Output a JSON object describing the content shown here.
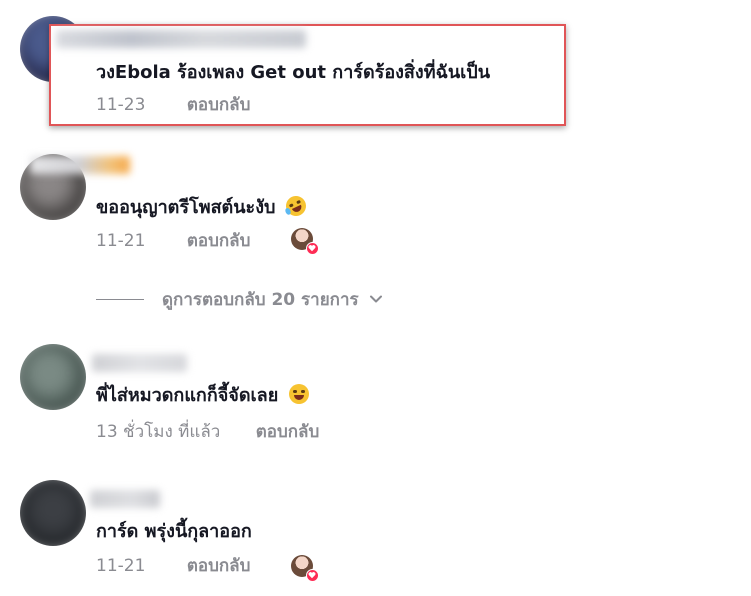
{
  "comments": [
    {
      "text": "วงEbola ร้องเพลง Get out การ์ดร้องสิ่งที่ฉันเป็น",
      "date": "11-23",
      "reply_label": "ตอบกลับ",
      "highlighted": true
    },
    {
      "text": "ขออนุญาตรีโพสต์นะงับ",
      "date": "11-21",
      "reply_label": "ตอบกลับ",
      "emoji": "rolling-laughing-emoji",
      "liked_by_creator": true
    },
    {
      "text": "พี่ไส่หมวดกแกก็จี้จัดเลย",
      "date": "13 ชั่วโมง ที่แล้ว",
      "reply_label": "ตอบกลับ",
      "emoji": "tears-of-joy-emoji"
    },
    {
      "text": "การ์ด พรุ่งนี้กุลาออก",
      "date": "11-21",
      "reply_label": "ตอบกลับ",
      "liked_by_creator": true
    }
  ],
  "view_replies": {
    "label": "ดูการตอบกลับ 20 รายการ",
    "icon": "chevron-down-icon"
  },
  "colors": {
    "highlight_border": "#e05557",
    "meta_text": "#8a8b91",
    "primary_text": "#161823",
    "heart": "#fe2c55"
  }
}
